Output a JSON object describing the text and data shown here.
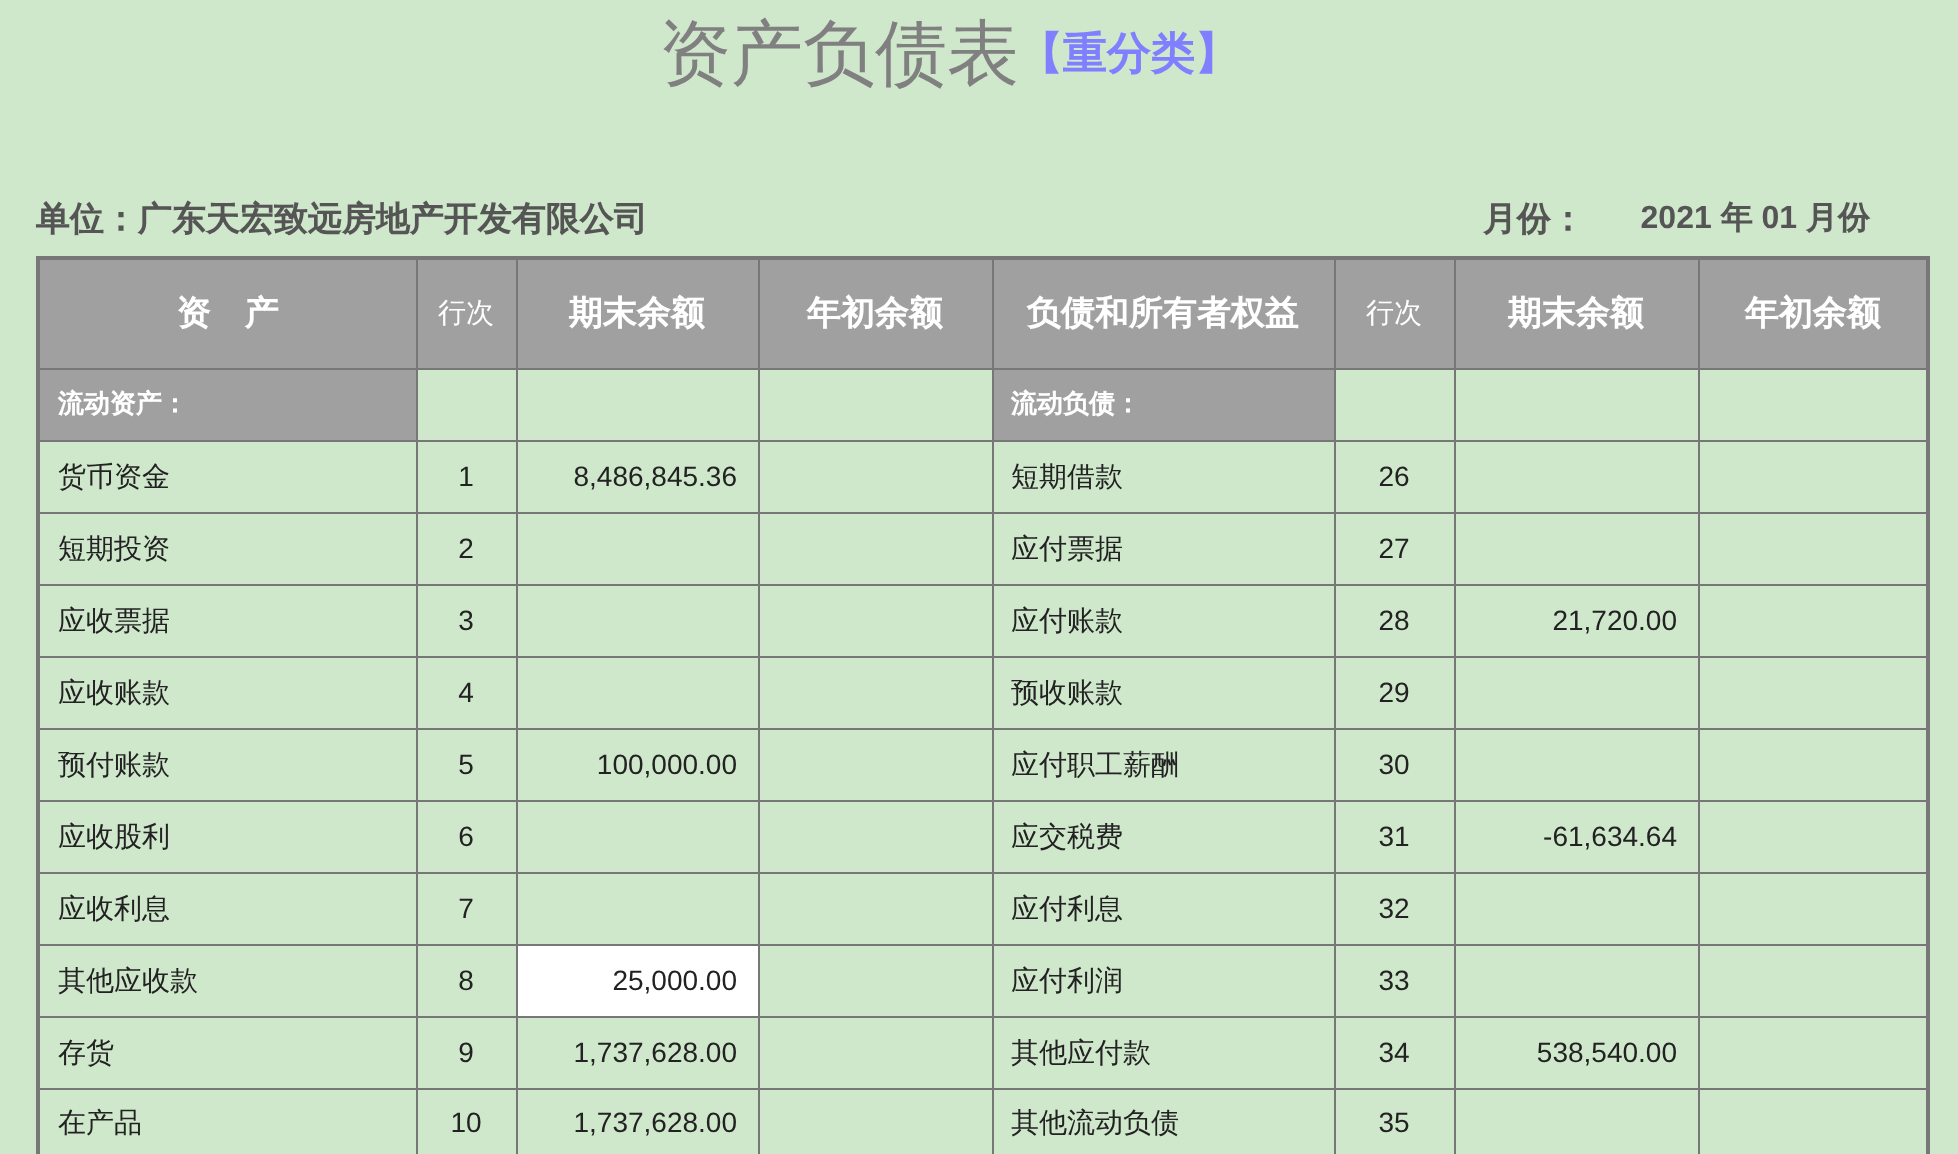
{
  "title": "资产负债表",
  "subtitle": "【重分类】",
  "unit": {
    "label": "单位：",
    "company": "广东天宏致远房地产开发有限公司"
  },
  "period": {
    "label": "月份：",
    "value": "2021 年 01 月份"
  },
  "table": {
    "columns": [
      {
        "label": "资　产",
        "kind": "main"
      },
      {
        "label": "行次",
        "kind": "line"
      },
      {
        "label": "期末余额",
        "kind": "main"
      },
      {
        "label": "年初余额",
        "kind": "main"
      },
      {
        "label": "负债和所有者权益",
        "kind": "main"
      },
      {
        "label": "行次",
        "kind": "line"
      },
      {
        "label": "期末余额",
        "kind": "main"
      },
      {
        "label": "年初余额",
        "kind": "main"
      }
    ],
    "sections": {
      "assets": "流动资产：",
      "liabilities": "流动负债："
    },
    "rows": [
      {
        "asset": "货币资金",
        "asset_line": "1",
        "asset_end": "8,486,845.36",
        "selected": false,
        "liability": "短期借款",
        "liability_line": "26"
      },
      {
        "asset": "短期投资",
        "asset_line": "2",
        "selected": false,
        "liability": "应付票据",
        "liability_line": "27"
      },
      {
        "asset": "应收票据",
        "asset_line": "3",
        "selected": false,
        "liability": "应付账款",
        "liability_line": "28",
        "liability_end": "21,720.00"
      },
      {
        "asset": "应收账款",
        "asset_line": "4",
        "selected": false,
        "liability": "预收账款",
        "liability_line": "29"
      },
      {
        "asset": "预付账款",
        "asset_line": "5",
        "asset_end": "100,000.00",
        "selected": false,
        "liability": "应付职工薪酬",
        "liability_line": "30"
      },
      {
        "asset": "应收股利",
        "asset_line": "6",
        "selected": false,
        "liability": "应交税费",
        "liability_line": "31",
        "liability_end": "-61,634.64"
      },
      {
        "asset": "应收利息",
        "asset_line": "7",
        "selected": false,
        "liability": "应付利息",
        "liability_line": "32"
      },
      {
        "asset": "其他应收款",
        "asset_line": "8",
        "asset_end": "25,000.00",
        "selected": true,
        "liability": "应付利润",
        "liability_line": "33"
      },
      {
        "asset": "存货",
        "asset_line": "9",
        "asset_end": "1,737,628.00",
        "selected": false,
        "liability": "其他应付款",
        "liability_line": "34",
        "liability_end": "538,540.00"
      },
      {
        "asset": "在产品",
        "asset_line": "10",
        "asset_end": "1,737,628.00",
        "selected": false,
        "liability": "其他流动负债",
        "liability_line": "35"
      }
    ]
  }
}
